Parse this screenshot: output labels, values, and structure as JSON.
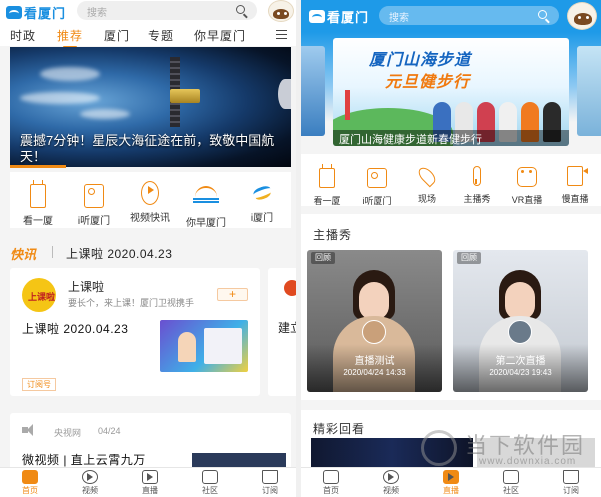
{
  "left": {
    "logo_text": "看厦门",
    "search_placeholder": "搜索",
    "nav_tabs": [
      "时政",
      "推荐",
      "厦门",
      "专题",
      "你早厦门"
    ],
    "active_tab": "推荐",
    "hero_title": "震撼7分钟！星辰大海征途在前，致敬中国航天！",
    "quick_icons": [
      {
        "label": "看一厦",
        "icon": "tv-icon"
      },
      {
        "label": "i听厦门",
        "icon": "radio-icon"
      },
      {
        "label": "视频快讯",
        "icon": "video-play-icon"
      },
      {
        "label": "你早厦门",
        "icon": "sunrise-icon"
      },
      {
        "label": "i厦门",
        "icon": "swirl-logo-icon"
      }
    ],
    "flash_badge": "快讯",
    "flash_text": "上课啦 2020.04.23",
    "card1": {
      "account_name": "上课啦",
      "logo_text": "上课啦",
      "description": "要长个，来上课！厦门卫视携手",
      "follow_label": "+",
      "title": "上课啦 2020.04.23",
      "tag": "订阅号"
    },
    "card1b": {
      "title": "建立统污"
    },
    "card2": {
      "source": "央视网",
      "date": "04/24",
      "title": "微视频 | 直上云霄九万"
    },
    "tabbar": [
      {
        "label": "首页",
        "active": true
      },
      {
        "label": "视频",
        "active": false
      },
      {
        "label": "直播",
        "active": false
      },
      {
        "label": "社区",
        "active": false
      },
      {
        "label": "订阅",
        "active": false
      }
    ]
  },
  "right": {
    "logo_text": "看厦门",
    "search_placeholder": "搜索",
    "banner": {
      "line1": "厦门山海步道",
      "line2": "元旦健步行",
      "caption": "厦门山海健康步道新春健步行"
    },
    "quick_icons": [
      {
        "label": "看一厦",
        "icon": "tv-icon"
      },
      {
        "label": "i听厦门",
        "icon": "radio-icon"
      },
      {
        "label": "现场",
        "icon": "location-pin-icon"
      },
      {
        "label": "主播秀",
        "icon": "microphone-icon"
      },
      {
        "label": "VR直播",
        "icon": "vr-icon"
      },
      {
        "label": "慢直播",
        "icon": "camera-icon"
      }
    ],
    "section1_title": "主播秀",
    "live_cards": [
      {
        "tag": "回顾",
        "name": "直播测试",
        "time": "2020/04/24 14:33"
      },
      {
        "tag": "回顾",
        "name": "第二次直播",
        "time": "2020/04/23 19:43"
      }
    ],
    "section2_title": "精彩回看",
    "watermark_line1": "当下软件园",
    "watermark_line2": "www.downxia.com",
    "tabbar": [
      {
        "label": "首页",
        "active": false
      },
      {
        "label": "视频",
        "active": false
      },
      {
        "label": "直播",
        "active": true
      },
      {
        "label": "社区",
        "active": false
      },
      {
        "label": "订阅",
        "active": false
      }
    ]
  },
  "colors": {
    "accent_orange": "#f08a14",
    "brand_blue": "#1e9ae8"
  }
}
